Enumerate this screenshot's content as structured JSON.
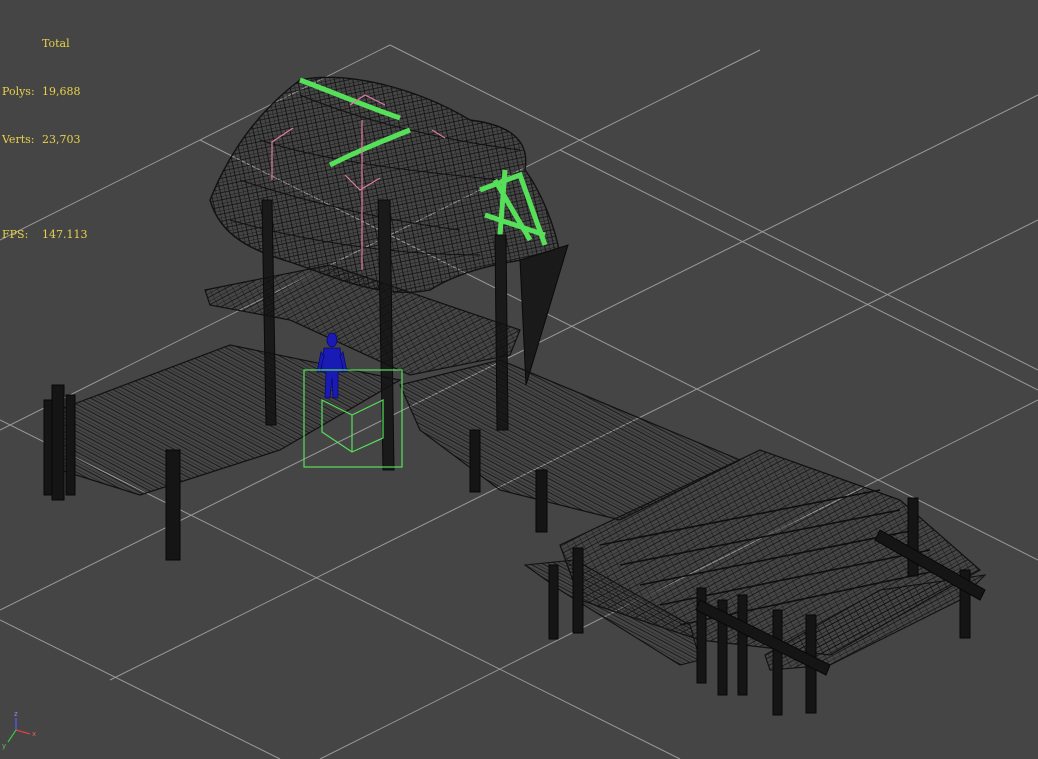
{
  "stats": {
    "header": "Total",
    "polys_label": "Polys:",
    "polys_value": "19,688",
    "verts_label": "Verts:",
    "verts_value": "23,703",
    "fps_label": "FPS:",
    "fps_value": "147.113"
  },
  "axis_gizmo": {
    "x_label": "x",
    "y_label": "y",
    "z_label": "z"
  },
  "colors": {
    "background": "#454545",
    "grid": "#9a9a9a",
    "wireframe": "#141414",
    "selection": "#56e05a",
    "character": "#1a1ab4",
    "camera": "#e07aa0",
    "stats_text": "#e8d24a"
  }
}
